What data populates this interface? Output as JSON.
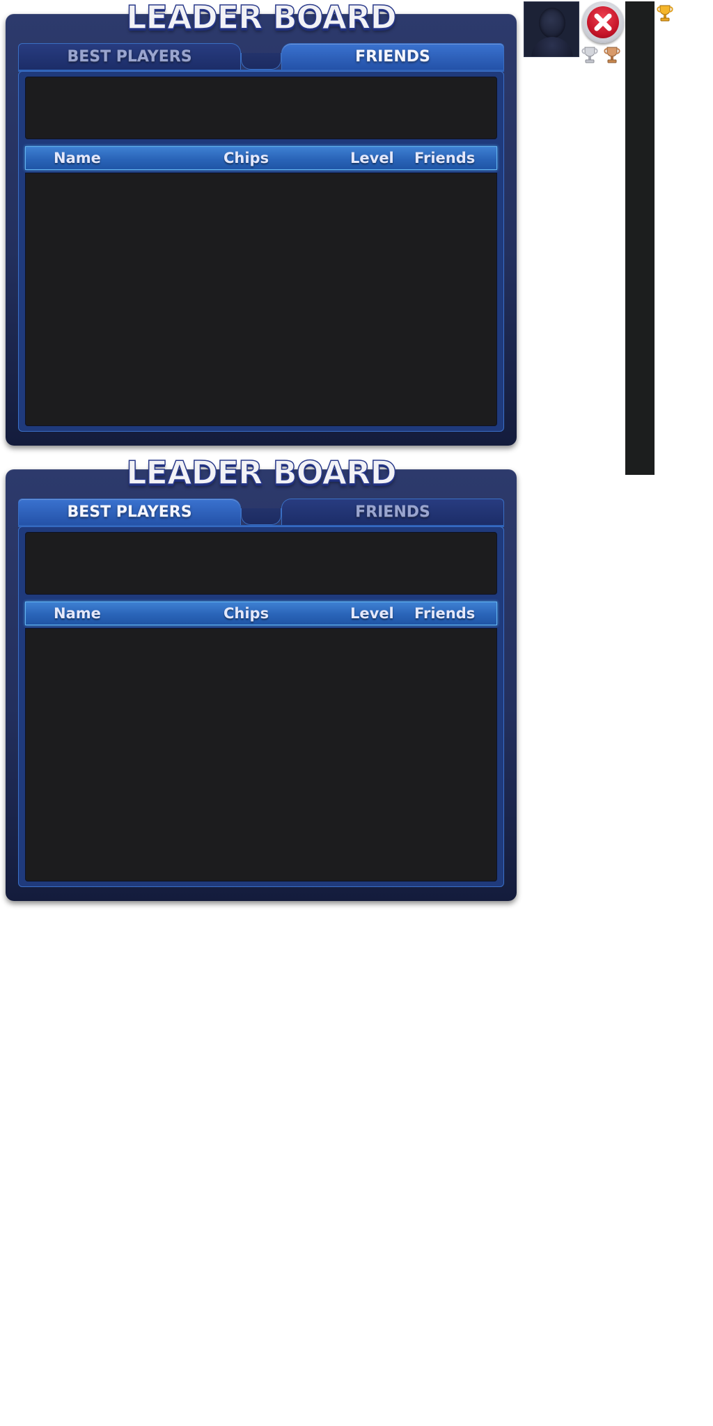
{
  "boards": [
    {
      "title": "LEADER BOARD",
      "tabs": [
        {
          "label": "BEST PLAYERS",
          "active": false
        },
        {
          "label": "FRIENDS",
          "active": true
        }
      ],
      "columns": [
        "Name",
        "Chips",
        "Level",
        "Friends"
      ]
    },
    {
      "title": "LEADER BOARD",
      "tabs": [
        {
          "label": "BEST PLAYERS",
          "active": true
        },
        {
          "label": "FRIENDS",
          "active": false
        }
      ],
      "columns": [
        "Name",
        "Chips",
        "Level",
        "Friends"
      ]
    }
  ],
  "sprites": {
    "avatar_icon": "default-avatar-silhouette",
    "close_icon": "close-x-icon",
    "trophies": [
      "silver-trophy-icon",
      "bronze-trophy-icon",
      "gold-trophy-icon"
    ]
  },
  "colors": {
    "panel": "#23305e",
    "tab_active": "#3a72cf",
    "tab_inactive": "#1c2d68",
    "header_bar": "#2a64b8",
    "content_bg": "#1c1c1e",
    "close_red": "#c41428",
    "gold": "#f0a020"
  }
}
